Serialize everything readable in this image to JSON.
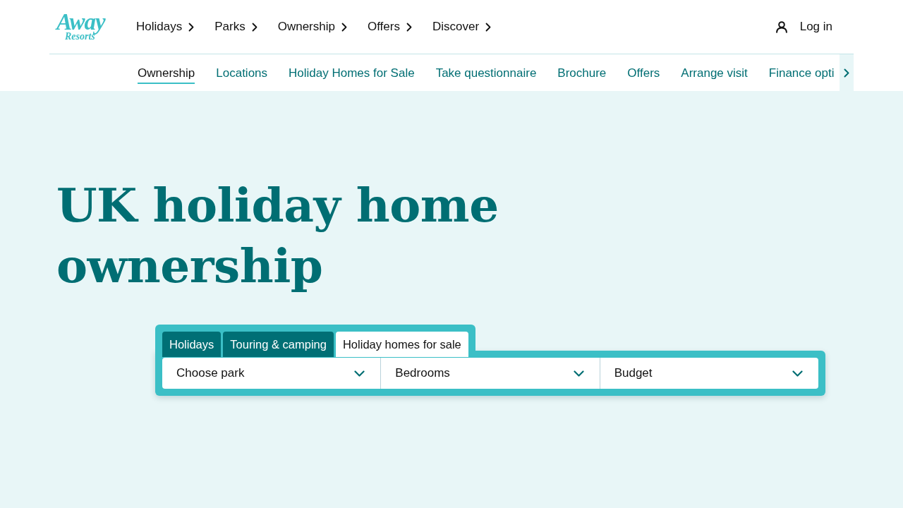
{
  "header": {
    "logo": {
      "top": "Away",
      "bottom": "Resorts"
    },
    "nav": [
      {
        "label": "Holidays"
      },
      {
        "label": "Parks"
      },
      {
        "label": "Ownership"
      },
      {
        "label": "Offers"
      },
      {
        "label": "Discover"
      }
    ],
    "login": {
      "label": "Log in"
    }
  },
  "subnav": {
    "items": [
      {
        "label": "Ownership",
        "selected": true
      },
      {
        "label": "Locations",
        "selected": false
      },
      {
        "label": "Holiday Homes for Sale",
        "selected": false
      },
      {
        "label": "Take questionnaire",
        "selected": false
      },
      {
        "label": "Brochure",
        "selected": false
      },
      {
        "label": "Offers",
        "selected": false
      },
      {
        "label": "Arrange visit",
        "selected": false
      },
      {
        "label": "Finance opti",
        "selected": false
      }
    ]
  },
  "hero": {
    "title": "UK holiday home ownership"
  },
  "search": {
    "tabs": [
      {
        "label": "Holidays",
        "selected": false
      },
      {
        "label": "Touring & camping",
        "selected": false
      },
      {
        "label": "Holiday homes for sale",
        "selected": true
      }
    ],
    "fields": [
      {
        "label": "Choose park"
      },
      {
        "label": "Bedrooms"
      },
      {
        "label": "Budget"
      }
    ]
  }
}
